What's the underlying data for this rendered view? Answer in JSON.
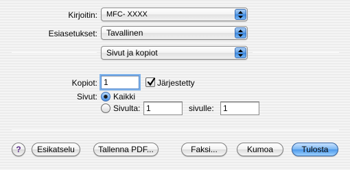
{
  "printer": {
    "label": "Kirjoitin:",
    "value": "MFC- XXXX"
  },
  "presets": {
    "label": "Esiasetukset:",
    "value": "Tavallinen"
  },
  "panel": {
    "value": "Sivut ja kopiot"
  },
  "copies": {
    "label": "Kopiot:",
    "value": "1",
    "collated_label": "Järjestetty",
    "collated_checked": true
  },
  "pages": {
    "label": "Sivut:",
    "all_label": "Kaikki",
    "range_label": "Sivulta:",
    "from_value": "1",
    "to_label": "sivulle:",
    "to_value": "1",
    "selected": "all"
  },
  "buttons": {
    "help": "?",
    "preview": "Esikatselu",
    "save_pdf": "Tallenna PDF...",
    "fax": "Faksi...",
    "cancel": "Kumoa",
    "print": "Tulosta"
  },
  "colors": {
    "accent": "#4d99ea",
    "default_button": "#7db7f3"
  },
  "icons": [
    "popup-arrows-icon",
    "checkmark-icon",
    "help-icon"
  ]
}
